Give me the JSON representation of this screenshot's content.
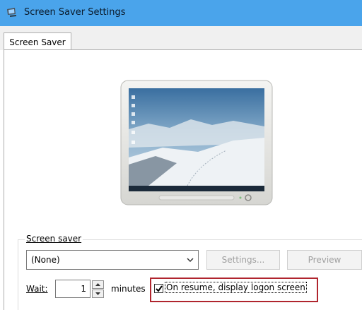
{
  "window": {
    "title": "Screen Saver Settings"
  },
  "tabs": [
    {
      "label": "Screen Saver"
    }
  ],
  "group": {
    "label": "Screen saver",
    "select": {
      "value": "(None)"
    },
    "buttons": {
      "settings": "Settings...",
      "preview": "Preview"
    }
  },
  "wait": {
    "label": "Wait:",
    "value": "1",
    "units": "minutes"
  },
  "resume_checkbox": {
    "label": "On resume, display logon screen",
    "checked": true
  },
  "colors": {
    "titlebar": "#4aa4eb",
    "highlight": "#b0252e"
  },
  "icons": [
    "screen-saver-app-icon",
    "chevron-down-icon",
    "spin-up-icon",
    "spin-down-icon",
    "check-icon",
    "monitor-preview-icon"
  ]
}
